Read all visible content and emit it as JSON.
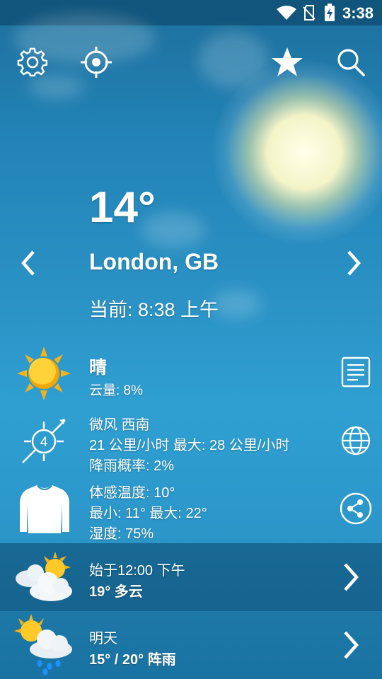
{
  "status_bar": {
    "time": "3:38"
  },
  "toolbar": {
    "settings_icon": "gear-icon",
    "locate_icon": "crosshair-icon",
    "favorite_icon": "star-icon",
    "search_icon": "search-icon"
  },
  "current": {
    "temperature": "14°",
    "city": "London, GB",
    "time_label": "当前: 8:38 上午"
  },
  "condition": {
    "title": "晴",
    "cloud": "云量: 8%"
  },
  "wind": {
    "level": "4",
    "title": "微风 西南",
    "speed": "21 公里/小时 最大: 28 公里/小时",
    "rain": "降雨概率: 2%"
  },
  "feel": {
    "feels_like": "体感温度: 10°",
    "min_max": "最小: 11° 最大: 22°",
    "humidity": "湿度: 75%"
  },
  "forecast": [
    {
      "line1": "始于12:00 下午",
      "line2": "19° 多云"
    },
    {
      "line1": "明天",
      "line2": "15° / 20° 阵雨"
    }
  ],
  "colors": {
    "accent": "#2b93c6",
    "status_bar": "#11557c"
  }
}
